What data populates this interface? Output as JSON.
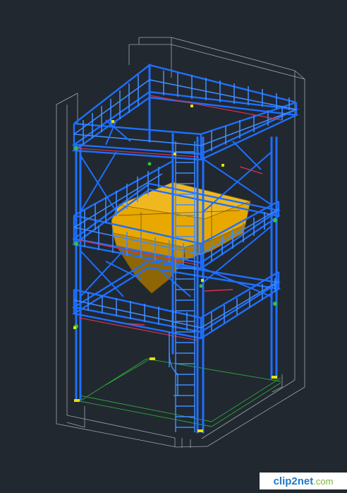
{
  "viewport": {
    "background": "#212830",
    "colors": {
      "structure": "#1e6fff",
      "structure_light": "#3d8bff",
      "envelope": "#b8bcc4",
      "hopper": "#e8a800",
      "hopper_dark": "#b37f00",
      "handrail_red": "#d83050",
      "ground_green": "#2fa83a",
      "node_yellow": "#e8e000",
      "node_green": "#30c040"
    }
  },
  "watermark": {
    "brand": "clip2net",
    "suffix": ".com",
    "brand_color": "#1f78c8",
    "suffix_color": "#7ab83a"
  }
}
